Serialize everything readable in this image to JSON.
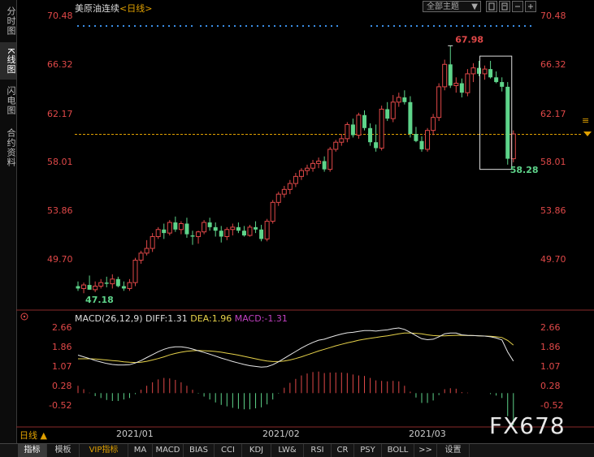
{
  "sidebar": {
    "tabs": [
      {
        "label": "分时图",
        "active": false
      },
      {
        "label": "K线图",
        "active": true
      },
      {
        "label": "闪电图",
        "active": false
      },
      {
        "label": "合约资料",
        "active": false
      }
    ]
  },
  "header": {
    "instrument": "美原油连续",
    "period": "<日线>",
    "theme_selector": "全部主题",
    "theme_arrow": "▼"
  },
  "price_axis_labels": [
    "70.48",
    "66.32",
    "62.17",
    "58.01",
    "53.86",
    "49.70"
  ],
  "current_price_marker": "≡",
  "macd": {
    "title": "MACD(26,12,9)",
    "diff_label": "DIFF:1.31",
    "dea_label": "DEA:1.96",
    "macd_label": "MACD:-1.31",
    "axis_labels": [
      "2.66",
      "1.86",
      "1.07",
      "0.28",
      "-0.52"
    ]
  },
  "date_axis": [
    "2021/01",
    "2021/02",
    "2021/03"
  ],
  "period_button": "日线 ▲",
  "bottom_tabs": [
    {
      "label": "指标",
      "active": true,
      "vip": false
    },
    {
      "label": "模板",
      "active": false,
      "vip": false
    },
    {
      "label": "VIP指标",
      "active": false,
      "vip": true
    },
    {
      "label": "MA",
      "active": false,
      "vip": false
    },
    {
      "label": "MACD",
      "active": false,
      "vip": false
    },
    {
      "label": "BIAS",
      "active": false,
      "vip": false
    },
    {
      "label": "CCI",
      "active": false,
      "vip": false
    },
    {
      "label": "KDJ",
      "active": false,
      "vip": false
    },
    {
      "label": "LW&",
      "active": false,
      "vip": false
    },
    {
      "label": "RSI",
      "active": false,
      "vip": false
    },
    {
      "label": "CR",
      "active": false,
      "vip": false
    },
    {
      "label": "PSY",
      "active": false,
      "vip": false
    },
    {
      "label": "BOLL",
      "active": false,
      "vip": false
    },
    {
      "label": ">>",
      "active": false,
      "vip": false
    },
    {
      "label": "设置",
      "active": false,
      "vip": false
    }
  ],
  "watermark": "FX678",
  "colors": {
    "up": "#e04848",
    "down": "#5ed48a",
    "diff": "#e8e8e8",
    "dea": "#e6d24a",
    "macd_hist_pos": "#e04848",
    "macd_hist_neg": "#5ed48a"
  },
  "chart_data": {
    "type": "candlestick",
    "price_range": [
      45.5,
      71.5
    ],
    "annotations": {
      "high": "67.98",
      "low": "47.18",
      "last": "58.28"
    },
    "candles": [
      {
        "o": 47.6,
        "h": 48.0,
        "l": 47.2,
        "c": 47.4
      },
      {
        "o": 47.4,
        "h": 47.9,
        "l": 47.0,
        "c": 47.7
      },
      {
        "o": 47.7,
        "h": 48.5,
        "l": 47.3,
        "c": 47.3
      },
      {
        "o": 47.3,
        "h": 48.0,
        "l": 47.1,
        "c": 47.6
      },
      {
        "o": 47.6,
        "h": 48.2,
        "l": 47.4,
        "c": 47.9
      },
      {
        "o": 47.9,
        "h": 48.4,
        "l": 47.5,
        "c": 47.8
      },
      {
        "o": 47.8,
        "h": 48.6,
        "l": 47.4,
        "c": 48.2
      },
      {
        "o": 48.2,
        "h": 48.4,
        "l": 47.5,
        "c": 47.6
      },
      {
        "o": 47.6,
        "h": 48.0,
        "l": 47.2,
        "c": 47.4
      },
      {
        "o": 47.4,
        "h": 48.2,
        "l": 47.2,
        "c": 47.9
      },
      {
        "o": 47.9,
        "h": 50.0,
        "l": 47.6,
        "c": 49.8
      },
      {
        "o": 49.8,
        "h": 50.6,
        "l": 49.5,
        "c": 50.4
      },
      {
        "o": 50.4,
        "h": 51.5,
        "l": 50.2,
        "c": 50.8
      },
      {
        "o": 50.8,
        "h": 52.1,
        "l": 50.5,
        "c": 51.8
      },
      {
        "o": 51.8,
        "h": 52.6,
        "l": 51.6,
        "c": 52.4
      },
      {
        "o": 52.4,
        "h": 52.9,
        "l": 51.6,
        "c": 52.1
      },
      {
        "o": 52.1,
        "h": 53.2,
        "l": 51.9,
        "c": 53.0
      },
      {
        "o": 53.0,
        "h": 53.5,
        "l": 52.2,
        "c": 52.4
      },
      {
        "o": 52.4,
        "h": 53.1,
        "l": 52.0,
        "c": 52.9
      },
      {
        "o": 52.9,
        "h": 53.4,
        "l": 51.7,
        "c": 52.0
      },
      {
        "o": 51.9,
        "h": 52.3,
        "l": 51.1,
        "c": 51.8
      },
      {
        "o": 51.8,
        "h": 52.3,
        "l": 51.2,
        "c": 52.2
      },
      {
        "o": 52.2,
        "h": 53.2,
        "l": 52.0,
        "c": 53.0
      },
      {
        "o": 53.0,
        "h": 53.4,
        "l": 52.3,
        "c": 52.6
      },
      {
        "o": 52.6,
        "h": 53.0,
        "l": 51.8,
        "c": 52.3
      },
      {
        "o": 52.3,
        "h": 52.7,
        "l": 51.3,
        "c": 51.8
      },
      {
        "o": 51.8,
        "h": 52.6,
        "l": 51.5,
        "c": 52.4
      },
      {
        "o": 52.4,
        "h": 52.9,
        "l": 51.9,
        "c": 52.6
      },
      {
        "o": 52.6,
        "h": 53.0,
        "l": 52.1,
        "c": 52.3
      },
      {
        "o": 52.3,
        "h": 52.7,
        "l": 51.8,
        "c": 51.9
      },
      {
        "o": 51.9,
        "h": 52.8,
        "l": 51.8,
        "c": 52.6
      },
      {
        "o": 52.6,
        "h": 53.1,
        "l": 52.1,
        "c": 52.4
      },
      {
        "o": 52.4,
        "h": 52.8,
        "l": 51.4,
        "c": 51.6
      },
      {
        "o": 51.6,
        "h": 53.3,
        "l": 51.4,
        "c": 53.1
      },
      {
        "o": 53.1,
        "h": 54.9,
        "l": 52.9,
        "c": 54.7
      },
      {
        "o": 54.7,
        "h": 55.6,
        "l": 54.4,
        "c": 55.4
      },
      {
        "o": 55.4,
        "h": 56.1,
        "l": 55.1,
        "c": 55.8
      },
      {
        "o": 55.8,
        "h": 56.6,
        "l": 55.4,
        "c": 56.3
      },
      {
        "o": 56.3,
        "h": 57.2,
        "l": 56.0,
        "c": 56.9
      },
      {
        "o": 56.9,
        "h": 57.6,
        "l": 56.6,
        "c": 57.4
      },
      {
        "o": 57.4,
        "h": 57.9,
        "l": 57.0,
        "c": 57.6
      },
      {
        "o": 57.6,
        "h": 58.3,
        "l": 57.3,
        "c": 58.0
      },
      {
        "o": 58.0,
        "h": 58.5,
        "l": 57.6,
        "c": 58.2
      },
      {
        "o": 58.2,
        "h": 58.6,
        "l": 57.3,
        "c": 57.5
      },
      {
        "o": 57.5,
        "h": 59.4,
        "l": 57.3,
        "c": 59.2
      },
      {
        "o": 59.2,
        "h": 60.0,
        "l": 59.0,
        "c": 59.8
      },
      {
        "o": 59.8,
        "h": 60.5,
        "l": 59.5,
        "c": 60.1
      },
      {
        "o": 60.1,
        "h": 61.5,
        "l": 59.8,
        "c": 61.3
      },
      {
        "o": 61.3,
        "h": 61.8,
        "l": 60.2,
        "c": 60.4
      },
      {
        "o": 60.4,
        "h": 62.3,
        "l": 60.1,
        "c": 62.1
      },
      {
        "o": 62.1,
        "h": 62.5,
        "l": 60.8,
        "c": 61.0
      },
      {
        "o": 61.0,
        "h": 61.4,
        "l": 59.5,
        "c": 59.8
      },
      {
        "o": 59.8,
        "h": 61.3,
        "l": 59.0,
        "c": 59.3
      },
      {
        "o": 59.3,
        "h": 62.9,
        "l": 59.1,
        "c": 62.6
      },
      {
        "o": 62.6,
        "h": 63.2,
        "l": 61.6,
        "c": 61.8
      },
      {
        "o": 61.8,
        "h": 63.8,
        "l": 61.5,
        "c": 63.2
      },
      {
        "o": 63.2,
        "h": 64.0,
        "l": 62.8,
        "c": 63.6
      },
      {
        "o": 63.6,
        "h": 64.2,
        "l": 63.0,
        "c": 63.2
      },
      {
        "o": 63.2,
        "h": 63.7,
        "l": 60.2,
        "c": 60.5
      },
      {
        "o": 60.5,
        "h": 61.1,
        "l": 59.8,
        "c": 59.9
      },
      {
        "o": 59.9,
        "h": 60.3,
        "l": 59.0,
        "c": 59.2
      },
      {
        "o": 59.2,
        "h": 61.0,
        "l": 59.0,
        "c": 60.8
      },
      {
        "o": 60.8,
        "h": 62.2,
        "l": 60.4,
        "c": 61.9
      },
      {
        "o": 61.9,
        "h": 64.8,
        "l": 61.6,
        "c": 64.5
      },
      {
        "o": 64.5,
        "h": 66.8,
        "l": 64.2,
        "c": 66.4
      },
      {
        "o": 66.4,
        "h": 67.98,
        "l": 64.4,
        "c": 64.6
      },
      {
        "o": 64.6,
        "h": 65.3,
        "l": 64.0,
        "c": 64.8
      },
      {
        "o": 64.8,
        "h": 65.2,
        "l": 63.6,
        "c": 64.0
      },
      {
        "o": 64.0,
        "h": 66.0,
        "l": 63.7,
        "c": 65.6
      },
      {
        "o": 65.6,
        "h": 66.5,
        "l": 64.9,
        "c": 66.1
      },
      {
        "o": 66.1,
        "h": 66.7,
        "l": 65.4,
        "c": 65.6
      },
      {
        "o": 65.6,
        "h": 66.3,
        "l": 65.1,
        "c": 66.0
      },
      {
        "o": 66.0,
        "h": 66.7,
        "l": 65.2,
        "c": 65.3
      },
      {
        "o": 65.3,
        "h": 65.8,
        "l": 64.8,
        "c": 64.9
      },
      {
        "o": 64.9,
        "h": 65.3,
        "l": 64.1,
        "c": 64.5
      },
      {
        "o": 64.5,
        "h": 64.9,
        "l": 57.9,
        "c": 58.4
      },
      {
        "o": 58.4,
        "h": 60.8,
        "l": 58.1,
        "c": 60.5
      }
    ],
    "macd_range": [
      -1.1,
      3.0
    ],
    "diff": [
      1.55,
      1.48,
      1.41,
      1.33,
      1.27,
      1.21,
      1.17,
      1.15,
      1.15,
      1.16,
      1.23,
      1.33,
      1.45,
      1.57,
      1.69,
      1.79,
      1.86,
      1.89,
      1.89,
      1.86,
      1.8,
      1.73,
      1.66,
      1.59,
      1.51,
      1.43,
      1.36,
      1.29,
      1.23,
      1.17,
      1.12,
      1.09,
      1.06,
      1.08,
      1.16,
      1.28,
      1.42,
      1.56,
      1.7,
      1.84,
      1.96,
      2.07,
      2.16,
      2.2,
      2.28,
      2.35,
      2.41,
      2.46,
      2.48,
      2.52,
      2.55,
      2.55,
      2.53,
      2.56,
      2.58,
      2.63,
      2.66,
      2.6,
      2.48,
      2.35,
      2.22,
      2.18,
      2.2,
      2.3,
      2.42,
      2.45,
      2.45,
      2.38,
      2.36,
      2.35,
      2.34,
      2.33,
      2.3,
      2.25,
      2.17,
      1.68,
      1.31
    ],
    "dea": [
      1.4,
      1.4,
      1.4,
      1.39,
      1.37,
      1.35,
      1.33,
      1.31,
      1.28,
      1.26,
      1.25,
      1.26,
      1.3,
      1.35,
      1.41,
      1.48,
      1.56,
      1.62,
      1.67,
      1.71,
      1.73,
      1.74,
      1.73,
      1.72,
      1.7,
      1.67,
      1.63,
      1.59,
      1.55,
      1.5,
      1.45,
      1.4,
      1.35,
      1.31,
      1.29,
      1.29,
      1.31,
      1.35,
      1.41,
      1.48,
      1.56,
      1.64,
      1.72,
      1.79,
      1.86,
      1.93,
      1.99,
      2.05,
      2.1,
      2.16,
      2.2,
      2.24,
      2.27,
      2.31,
      2.34,
      2.38,
      2.42,
      2.45,
      2.45,
      2.44,
      2.42,
      2.38,
      2.35,
      2.34,
      2.34,
      2.35,
      2.36,
      2.36,
      2.35,
      2.35,
      2.34,
      2.33,
      2.32,
      2.3,
      2.27,
      2.15,
      1.96
    ],
    "macd": [
      0.3,
      0.16,
      0.02,
      -0.12,
      -0.2,
      -0.28,
      -0.32,
      -0.32,
      -0.26,
      -0.2,
      -0.04,
      0.14,
      0.3,
      0.44,
      0.56,
      0.62,
      0.6,
      0.54,
      0.44,
      0.3,
      0.14,
      -0.02,
      -0.14,
      -0.26,
      -0.38,
      -0.48,
      -0.54,
      -0.6,
      -0.64,
      -0.66,
      -0.66,
      -0.62,
      -0.58,
      -0.46,
      -0.26,
      -0.02,
      0.22,
      0.42,
      0.58,
      0.72,
      0.8,
      0.86,
      0.88,
      0.82,
      0.84,
      0.84,
      0.84,
      0.82,
      0.76,
      0.72,
      0.7,
      0.62,
      0.52,
      0.5,
      0.48,
      0.5,
      0.48,
      0.3,
      0.06,
      -0.18,
      -0.4,
      -0.4,
      -0.3,
      -0.08,
      0.16,
      0.2,
      0.18,
      0.04,
      0.02,
      0.0,
      0.0,
      0.0,
      -0.04,
      -0.1,
      -0.2,
      -0.94,
      -1.31
    ]
  }
}
